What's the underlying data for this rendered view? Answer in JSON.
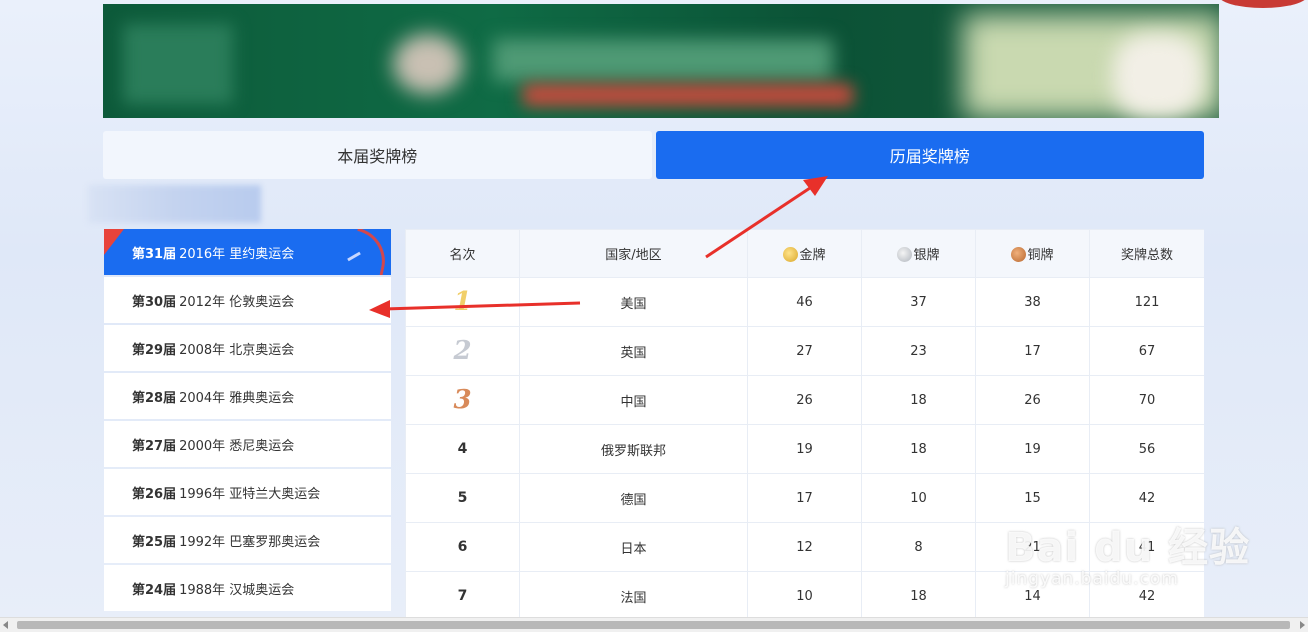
{
  "tabs": [
    {
      "label": "本届奖牌榜",
      "active": false
    },
    {
      "label": "历届奖牌榜",
      "active": true
    }
  ],
  "games": [
    {
      "edition": "第31届",
      "desc": "2016年 里约奥运会",
      "active": true
    },
    {
      "edition": "第30届",
      "desc": "2012年 伦敦奥运会",
      "active": false
    },
    {
      "edition": "第29届",
      "desc": "2008年 北京奥运会",
      "active": false
    },
    {
      "edition": "第28届",
      "desc": "2004年 雅典奥运会",
      "active": false
    },
    {
      "edition": "第27届",
      "desc": "2000年 悉尼奥运会",
      "active": false
    },
    {
      "edition": "第26届",
      "desc": "1996年 亚特兰大奥运会",
      "active": false
    },
    {
      "edition": "第25届",
      "desc": "1992年 巴塞罗那奥运会",
      "active": false
    },
    {
      "edition": "第24届",
      "desc": "1988年 汉城奥运会",
      "active": false
    }
  ],
  "table": {
    "headers": {
      "rank": "名次",
      "country": "国家/地区",
      "gold": "金牌",
      "silver": "银牌",
      "bronze": "铜牌",
      "total": "奖牌总数"
    },
    "rows": [
      {
        "rank": "1",
        "country": "美国",
        "gold": "46",
        "silver": "37",
        "bronze": "38",
        "total": "121"
      },
      {
        "rank": "2",
        "country": "英国",
        "gold": "27",
        "silver": "23",
        "bronze": "17",
        "total": "67"
      },
      {
        "rank": "3",
        "country": "中国",
        "gold": "26",
        "silver": "18",
        "bronze": "26",
        "total": "70"
      },
      {
        "rank": "4",
        "country": "俄罗斯联邦",
        "gold": "19",
        "silver": "18",
        "bronze": "19",
        "total": "56"
      },
      {
        "rank": "5",
        "country": "德国",
        "gold": "17",
        "silver": "10",
        "bronze": "15",
        "total": "42"
      },
      {
        "rank": "6",
        "country": "日本",
        "gold": "12",
        "silver": "8",
        "bronze": "21",
        "total": "41"
      },
      {
        "rank": "7",
        "country": "法国",
        "gold": "10",
        "silver": "18",
        "bronze": "14",
        "total": "42"
      }
    ]
  },
  "watermark": {
    "logo": "Bai du 经验",
    "url": "jingyan.baidu.com"
  },
  "colors": {
    "accent": "#1a6cf0",
    "annotation_arrow": "#e8302a"
  }
}
